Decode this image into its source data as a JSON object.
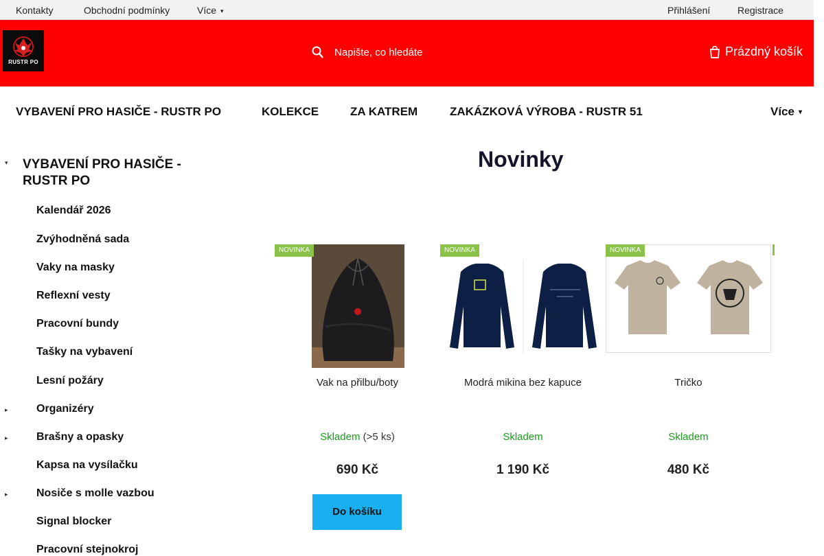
{
  "topbar": {
    "contacts": "Kontakty",
    "terms": "Obchodní podmínky",
    "more": "Více",
    "login": "Přihlášení",
    "register": "Registrace"
  },
  "header": {
    "logo_text": "RUSTR PO",
    "search_placeholder": "Napište, co hledáte",
    "cart_label": "Prázdný košík",
    "background_color": "#ff0000"
  },
  "main_nav": {
    "items": [
      "VYBAVENÍ PRO HASIČE - RUSTR PO",
      "KOLEKCE",
      "ZA KATREM",
      "ZAKÁZKOVÁ VÝROBA - RUSTR 51"
    ],
    "more": "Více"
  },
  "sidebar": {
    "heading": "VYBAVENÍ PRO HASIČE - RUSTR PO",
    "items": [
      "Kalendář 2026",
      "Zvýhodněná sada",
      "Vaky na masky",
      "Reflexní vesty",
      "Pracovní bundy",
      "Tašky na vybavení",
      "Lesní požáry",
      "Organizéry",
      "Brašny a opasky",
      "Kapsa na vysílačku",
      "Nosiče s molle vazbou",
      "Signal blocker",
      "Pracovní stejnokroj"
    ]
  },
  "content": {
    "section_title": "Novinky",
    "products": [
      {
        "badge": "NOVINKA",
        "name": "Vak na přilbu/boty",
        "stock": "Skladem",
        "stock_amount": "(>5 ks)",
        "price": "690 Kč",
        "button": "Do košíku"
      },
      {
        "badge": "NOVINKA",
        "name": "Modrá mikina bez kapuce",
        "stock": "Skladem",
        "stock_amount": "",
        "price": "1 190 Kč",
        "button": ""
      },
      {
        "badge": "NOVINKA",
        "name": "Tričko",
        "stock": "Skladem",
        "stock_amount": "",
        "price": "480 Kč",
        "button": ""
      }
    ],
    "badge_color": "#8bc34a",
    "stock_color": "#1a9c1a",
    "button_color": "#1ab0f0"
  }
}
